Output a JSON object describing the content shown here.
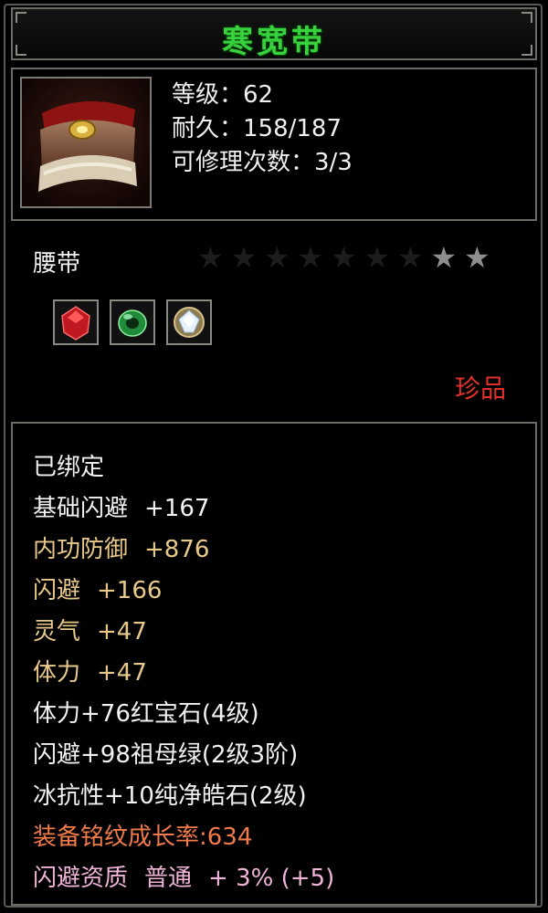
{
  "item": {
    "name": "寒宽带",
    "level_line": "等级：62",
    "durability_line": "耐久：158/187",
    "repair_line": "可修理次数：3/3",
    "type": "腰带",
    "rarity": "珍品",
    "stars_total": 9,
    "stars_lit": 2,
    "gems": [
      {
        "name": "ruby-gem-icon",
        "color": "#d0202a"
      },
      {
        "name": "emerald-gem-icon",
        "color": "#2fa84a"
      },
      {
        "name": "diamond-gem-icon",
        "color": "#c8d4e0"
      }
    ]
  },
  "attributes": {
    "bound": "已绑定",
    "base_evasion": {
      "label": "基础闪避",
      "value": "+167"
    },
    "inner_defense": {
      "label": "内功防御",
      "value": "+876"
    },
    "evasion": {
      "label": "闪避",
      "value": "+166"
    },
    "spirit": {
      "label": "灵气",
      "value": "+47"
    },
    "stamina": {
      "label": "体力",
      "value": "+47"
    },
    "gem_line_1": "体力+76红宝石(4级)",
    "gem_line_2": "闪避+98祖母绿(2级3阶)",
    "gem_line_3": "冰抗性+10纯净皓石(2级)",
    "growth_rate": "装备铭纹成长率:634",
    "quality": {
      "label": "闪避资质",
      "grade": "普通",
      "bonus": "+ 3% (+5)"
    }
  },
  "colors": {
    "title_green": "#39d23f",
    "rarity_red": "#e0322a",
    "attr_gold": "#e8c98a",
    "growth_orange": "#f07a4a",
    "quality_pink": "#f0b4d8"
  }
}
